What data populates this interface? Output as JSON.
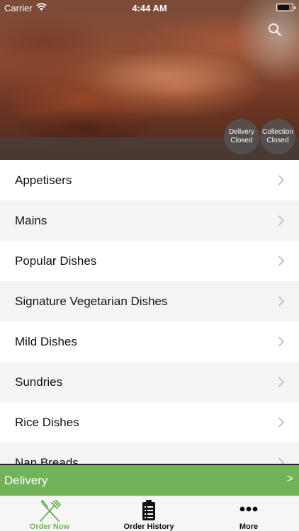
{
  "status_bar": {
    "carrier": "Carrier",
    "time": "4:44 AM",
    "battery_level": 0.8
  },
  "header": {
    "search_icon": "search-icon",
    "badges": {
      "delivery": {
        "line1": "Delivery",
        "line2": "Closed"
      },
      "collection": {
        "line1": "Collection",
        "line2": "Closed"
      }
    }
  },
  "categories": [
    {
      "label": "Appetisers"
    },
    {
      "label": "Mains"
    },
    {
      "label": "Popular Dishes"
    },
    {
      "label": "Signature Vegetarian Dishes"
    },
    {
      "label": "Mild Dishes"
    },
    {
      "label": "Sundries"
    },
    {
      "label": "Rice Dishes"
    },
    {
      "label": "Nan Breads"
    }
  ],
  "delivery_bar": {
    "label": "Delivery",
    "arrow": ">"
  },
  "tabs": {
    "order_now": {
      "label": "Order Now",
      "icon": "fork-knife-icon"
    },
    "order_history": {
      "label": "Order History",
      "icon": "clipboard-icon"
    },
    "more": {
      "label": "More",
      "icon": "more-dots-icon"
    }
  },
  "colors": {
    "accent_green": "#72b35a",
    "badge_bg": "#555555",
    "row_alt": "#f3f4f6"
  }
}
